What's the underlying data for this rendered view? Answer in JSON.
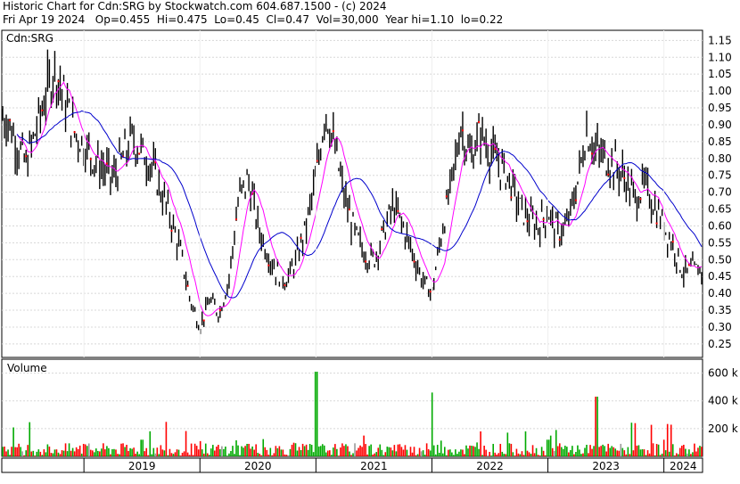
{
  "header": {
    "line1": "Historic Chart for Cdn:SRG by Stockwatch.com 604.687.1500 - (c) 2024",
    "line2": "Fri Apr 19 2024   Op=0.455  Hi=0.475  Lo=0.45  Cl=0.47  Vol=30,000  Year hi=1.10  lo=0.22"
  },
  "chart_data": [
    {
      "type": "candlestick",
      "title": "Cdn:SRG",
      "y_ticks": [
        0.25,
        0.3,
        0.35,
        0.4,
        0.45,
        0.5,
        0.55,
        0.6,
        0.65,
        0.7,
        0.75,
        0.8,
        0.85,
        0.9,
        0.95,
        1.0,
        1.05,
        1.1,
        1.15
      ],
      "ylim": [
        0.21,
        1.18
      ],
      "grid": true,
      "colors": {
        "bar": "#000000",
        "ma_short": "#ff00ff",
        "ma_long": "#0000cc",
        "down_tick": "#ff0000"
      },
      "series": [
        {
          "name": "price",
          "points": [
            [
              "2018-05",
              0.92
            ],
            [
              "2018-07",
              0.78
            ],
            [
              "2018-09",
              0.98
            ],
            [
              "2018-10",
              1.07
            ],
            [
              "2018-12",
              0.88
            ],
            [
              "2019-02",
              0.8
            ],
            [
              "2019-04",
              0.74
            ],
            [
              "2019-06",
              0.86
            ],
            [
              "2019-08",
              0.78
            ],
            [
              "2019-09",
              0.7
            ],
            [
              "2019-10",
              0.62
            ],
            [
              "2019-11",
              0.52
            ],
            [
              "2019-12",
              0.38
            ],
            [
              "2020-01",
              0.3
            ],
            [
              "2020-02",
              0.38
            ],
            [
              "2020-03",
              0.34
            ],
            [
              "2020-04",
              0.44
            ],
            [
              "2020-05",
              0.68
            ],
            [
              "2020-06",
              0.74
            ],
            [
              "2020-07",
              0.6
            ],
            [
              "2020-08",
              0.52
            ],
            [
              "2020-09",
              0.46
            ],
            [
              "2020-10",
              0.44
            ],
            [
              "2020-11",
              0.5
            ],
            [
              "2020-12",
              0.6
            ],
            [
              "2021-01",
              0.74
            ],
            [
              "2021-02",
              0.95
            ],
            [
              "2021-03",
              0.82
            ],
            [
              "2021-04",
              0.68
            ],
            [
              "2021-05",
              0.58
            ],
            [
              "2021-06",
              0.52
            ],
            [
              "2021-07",
              0.5
            ],
            [
              "2021-08",
              0.58
            ],
            [
              "2021-09",
              0.66
            ],
            [
              "2021-10",
              0.6
            ],
            [
              "2021-11",
              0.52
            ],
            [
              "2021-12",
              0.44
            ],
            [
              "2022-01",
              0.4
            ],
            [
              "2022-02",
              0.58
            ],
            [
              "2022-03",
              0.72
            ],
            [
              "2022-04",
              0.9
            ],
            [
              "2022-05",
              0.8
            ],
            [
              "2022-06",
              0.88
            ],
            [
              "2022-07",
              0.82
            ],
            [
              "2022-08",
              0.78
            ],
            [
              "2022-09",
              0.74
            ],
            [
              "2022-10",
              0.66
            ],
            [
              "2022-11",
              0.62
            ],
            [
              "2022-12",
              0.6
            ],
            [
              "2023-01",
              0.64
            ],
            [
              "2023-02",
              0.58
            ],
            [
              "2023-03",
              0.6
            ],
            [
              "2023-04",
              0.72
            ],
            [
              "2023-05",
              0.88
            ],
            [
              "2023-06",
              0.82
            ],
            [
              "2023-07",
              0.8
            ],
            [
              "2023-08",
              0.78
            ],
            [
              "2023-09",
              0.74
            ],
            [
              "2023-10",
              0.68
            ],
            [
              "2023-11",
              0.72
            ],
            [
              "2023-12",
              0.66
            ],
            [
              "2024-01",
              0.6
            ],
            [
              "2024-02",
              0.54
            ],
            [
              "2024-03",
              0.46
            ],
            [
              "2024-04",
              0.47
            ]
          ]
        }
      ]
    },
    {
      "type": "bar",
      "title": "Volume",
      "y_ticks": [
        "200 k",
        "400 k",
        "600 k"
      ],
      "ylim": [
        0,
        700000
      ],
      "x_tick_labels": [
        "2019",
        "2020",
        "2021",
        "2022",
        "2023",
        "2024"
      ],
      "colors": {
        "up": "#00aa00",
        "down": "#ff0000",
        "neutral": "#999999"
      },
      "series": [
        {
          "name": "volume",
          "points": [
            [
              "2019-01",
              90000
            ],
            [
              "2019-07",
              120000
            ],
            [
              "2020-01",
              110000
            ],
            [
              "2020-06",
              90000
            ],
            [
              "2021-01",
              610000
            ],
            [
              "2021-06",
              150000
            ],
            [
              "2022-01",
              460000
            ],
            [
              "2022-06",
              180000
            ],
            [
              "2023-01",
              120000
            ],
            [
              "2023-06",
              430000
            ],
            [
              "2024-01",
              120000
            ],
            [
              "2024-04",
              30000
            ]
          ]
        }
      ]
    }
  ]
}
